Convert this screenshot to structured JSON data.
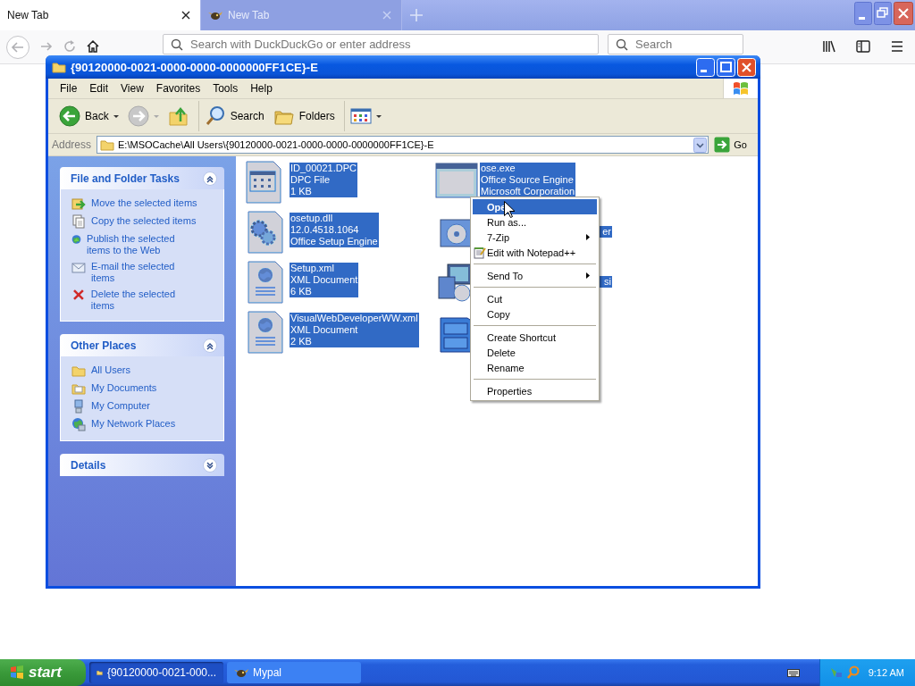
{
  "browser": {
    "tabs": [
      {
        "label": "New Tab",
        "selected": true,
        "favicon": false
      },
      {
        "label": "New Tab",
        "selected": false,
        "favicon": true
      }
    ],
    "address": {
      "placeholder": "Search with DuckDuckGo or enter address"
    },
    "search": {
      "placeholder": "Search"
    }
  },
  "explorer": {
    "title": "{90120000-0021-0000-0000-0000000FF1CE}-E",
    "menu": [
      "File",
      "Edit",
      "View",
      "Favorites",
      "Tools",
      "Help"
    ],
    "toolbar": [
      {
        "kind": "back",
        "label": "Back"
      },
      {
        "kind": "forward"
      },
      {
        "kind": "up"
      },
      {
        "kind": "search",
        "label": "Search"
      },
      {
        "kind": "folders",
        "label": "Folders"
      },
      {
        "kind": "views"
      }
    ],
    "address": {
      "label": "Address",
      "value": "E:\\MSOCache\\All Users\\{90120000-0021-0000-0000-0000000FF1CE}-E",
      "go": "Go"
    },
    "panels": [
      {
        "title": "File and Folder Tasks",
        "expanded": true,
        "items": [
          {
            "kind": "move",
            "label": "Move the selected items"
          },
          {
            "kind": "copy",
            "label": "Copy the selected items"
          },
          {
            "kind": "publish",
            "label": "Publish the selected items to the Web"
          },
          {
            "kind": "email",
            "label": "E-mail the selected items"
          },
          {
            "kind": "delete",
            "label": "Delete the selected items"
          }
        ]
      },
      {
        "title": "Other Places",
        "expanded": true,
        "items": [
          {
            "kind": "folder",
            "label": "All Users"
          },
          {
            "kind": "documents",
            "label": "My Documents"
          },
          {
            "kind": "computer",
            "label": "My Computer"
          },
          {
            "kind": "network",
            "label": "My Network Places"
          }
        ]
      },
      {
        "title": "Details",
        "expanded": false
      }
    ],
    "files": [
      {
        "kind": "dpc",
        "selected": true,
        "lines": [
          "ID_00021.DPC",
          "DPC File",
          "1 KB"
        ]
      },
      {
        "kind": "exe",
        "selected": true,
        "lines": [
          "ose.exe",
          "Office Source Engine",
          "Microsoft Corporation"
        ]
      },
      {
        "kind": "dll",
        "selected": true,
        "lines": [
          "osetup.dll",
          "12.0.4518.1064",
          "Office Setup Engine"
        ]
      },
      {
        "kind": "setup",
        "selected": true,
        "covered": true,
        "lines": [
          "er"
        ]
      },
      {
        "kind": "xml",
        "selected": true,
        "lines": [
          "Setup.xml",
          "XML Document",
          "6 KB"
        ]
      },
      {
        "kind": "install",
        "selected": true,
        "covered": true,
        "lines": [
          "si"
        ]
      },
      {
        "kind": "xml",
        "selected": true,
        "lines": [
          "VisualWebDeveloperWW.xml",
          "XML Document",
          "2 KB"
        ]
      },
      {
        "kind": "cabinet"
      }
    ],
    "context_menu": [
      {
        "kind": "item",
        "label": "Ope",
        "default": true,
        "selected": true
      },
      {
        "kind": "item",
        "label": "Run as...",
        "default": false,
        "selected": false
      },
      {
        "kind": "submenu",
        "label": "7-Zip",
        "default": false,
        "selected": false
      },
      {
        "kind": "notepad",
        "label": "Edit with Notepad++",
        "default": false,
        "selected": false
      },
      {
        "kind": "separator"
      },
      {
        "kind": "submenu",
        "label": "Send To",
        "default": false,
        "selected": false
      },
      {
        "kind": "separator"
      },
      {
        "kind": "item",
        "label": "Cut",
        "default": false,
        "selected": false
      },
      {
        "kind": "item",
        "label": "Copy",
        "default": false,
        "selected": false
      },
      {
        "kind": "separator"
      },
      {
        "kind": "item",
        "label": "Create Shortcut",
        "default": false,
        "selected": false
      },
      {
        "kind": "item",
        "label": "Delete",
        "default": false,
        "selected": false
      },
      {
        "kind": "item",
        "label": "Rename",
        "default": false,
        "selected": false
      },
      {
        "kind": "separator"
      },
      {
        "kind": "item",
        "label": "Properties",
        "default": false,
        "selected": false
      }
    ]
  },
  "taskbar": {
    "start": "start",
    "tasks": [
      {
        "kind": "folder",
        "label": "{90120000-0021-000...",
        "selected": true
      },
      {
        "kind": "bird",
        "label": "Mypal",
        "selected": false
      }
    ],
    "clock": "9:12 AM"
  }
}
